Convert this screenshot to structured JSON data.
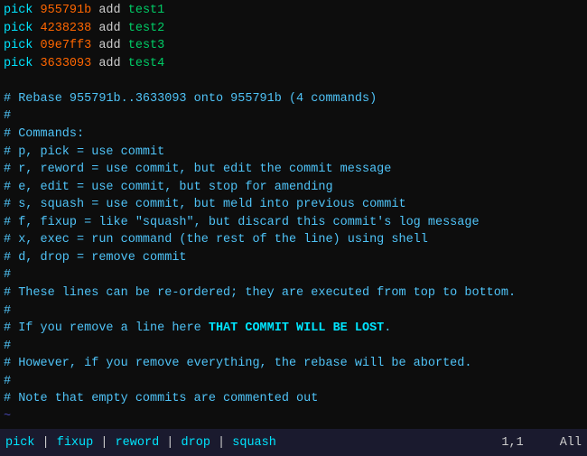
{
  "editor": {
    "lines": [
      {
        "type": "code",
        "content": [
          {
            "cls": "c-bright-cyan",
            "text": "pick"
          },
          {
            "cls": "c-white",
            "text": " "
          },
          {
            "cls": "c-orange",
            "text": "955791b"
          },
          {
            "cls": "c-white",
            "text": " add "
          },
          {
            "cls": "c-green",
            "text": "test1"
          }
        ]
      },
      {
        "type": "code",
        "content": [
          {
            "cls": "c-bright-cyan",
            "text": "pick"
          },
          {
            "cls": "c-white",
            "text": " "
          },
          {
            "cls": "c-orange",
            "text": "4238238"
          },
          {
            "cls": "c-white",
            "text": " add "
          },
          {
            "cls": "c-green",
            "text": "test2"
          }
        ]
      },
      {
        "type": "code",
        "content": [
          {
            "cls": "c-bright-cyan",
            "text": "pick"
          },
          {
            "cls": "c-white",
            "text": " "
          },
          {
            "cls": "c-orange",
            "text": "09e7ff3"
          },
          {
            "cls": "c-white",
            "text": " add "
          },
          {
            "cls": "c-green",
            "text": "test3"
          }
        ]
      },
      {
        "type": "code",
        "content": [
          {
            "cls": "c-bright-cyan",
            "text": "pick"
          },
          {
            "cls": "c-white",
            "text": " "
          },
          {
            "cls": "c-orange",
            "text": "3633093"
          },
          {
            "cls": "c-white",
            "text": " add "
          },
          {
            "cls": "c-green",
            "text": "test4"
          }
        ]
      },
      {
        "type": "empty"
      },
      {
        "type": "comment",
        "text": "# Rebase 955791b..3633093 onto 955791b (4 commands)"
      },
      {
        "type": "comment",
        "text": "#"
      },
      {
        "type": "comment",
        "text": "# Commands:"
      },
      {
        "type": "comment",
        "text": "# p, pick = use commit"
      },
      {
        "type": "comment",
        "text": "# r, reword = use commit, but edit the commit message"
      },
      {
        "type": "comment",
        "text": "# e, edit = use commit, but stop for amending"
      },
      {
        "type": "comment",
        "text": "# s, squash = use commit, but meld into previous commit"
      },
      {
        "type": "comment",
        "text": "# f, fixup = like \"squash\", but discard this commit's log message"
      },
      {
        "type": "comment",
        "text": "# x, exec = run command (the rest of the line) using shell"
      },
      {
        "type": "comment",
        "text": "# d, drop = remove commit"
      },
      {
        "type": "comment",
        "text": "#"
      },
      {
        "type": "comment",
        "text": "# These lines can be re-ordered; they are executed from top to bottom."
      },
      {
        "type": "comment",
        "text": "#"
      },
      {
        "type": "comment",
        "text": "# If you remove a line here THAT COMMIT WILL BE LOST."
      },
      {
        "type": "comment",
        "text": "#"
      },
      {
        "type": "comment",
        "text": "# However, if you remove everything, the rebase will be aborted."
      },
      {
        "type": "comment",
        "text": "#"
      },
      {
        "type": "comment",
        "text": "# Note that empty commits are commented out"
      },
      {
        "type": "tilde"
      },
      {
        "type": "tilde"
      }
    ]
  },
  "statusbar": {
    "commands": [
      {
        "label": "pick",
        "cls": "status-cmd"
      },
      {
        "label": "|",
        "cls": "status-sep"
      },
      {
        "label": "fixup",
        "cls": "status-cmd"
      },
      {
        "label": "|",
        "cls": "status-sep"
      },
      {
        "label": "reword",
        "cls": "status-cmd"
      },
      {
        "label": "|",
        "cls": "status-sep"
      },
      {
        "label": "drop",
        "cls": "status-cmd"
      },
      {
        "label": "|",
        "cls": "status-sep"
      },
      {
        "label": "squash",
        "cls": "status-cmd"
      }
    ],
    "position": "1,1",
    "scroll": "All"
  }
}
